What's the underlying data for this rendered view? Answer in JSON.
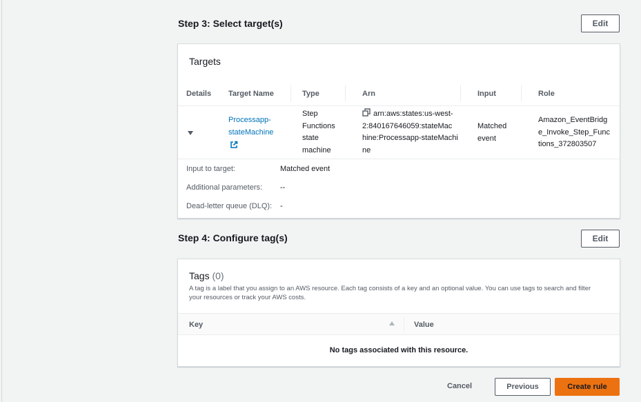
{
  "step3": {
    "title": "Step 3: Select target(s)",
    "edit_label": "Edit",
    "panel_title": "Targets",
    "columns": [
      "Details",
      "Target Name",
      "Type",
      "Arn",
      "Input",
      "Role"
    ],
    "row": {
      "name": "Processapp-stateMachine",
      "name_lines": [
        "Processapp-",
        "stateMachine"
      ],
      "type_lines": [
        "Step",
        "Functions",
        "state",
        "machine"
      ],
      "arn_lines": [
        "arn:aws:states:us-west-",
        "2:840167646059:stateMac",
        "hine:Processapp-stateMachi",
        "ne"
      ],
      "input_lines": [
        "Matched",
        "event"
      ],
      "role_lines": [
        "Amazon_EventBridg",
        "e_Invoke_Step_Func",
        "tions_372803507"
      ]
    },
    "details": [
      {
        "label": "Input to target:",
        "value": "Matched event"
      },
      {
        "label": "Additional parameters:",
        "value": "--"
      },
      {
        "label": "Dead-letter queue (DLQ):",
        "value": "-"
      }
    ]
  },
  "step4": {
    "title": "Step 4: Configure tag(s)",
    "edit_label": "Edit",
    "panel_title": "Tags",
    "count": "(0)",
    "description": "A tag is a label that you assign to an AWS resource. Each tag consists of a key and an optional value. You can use tags to search and filter your resources or track your AWS costs.",
    "col_key": "Key",
    "col_value": "Value",
    "empty": "No tags associated with this resource."
  },
  "footer": {
    "cancel": "Cancel",
    "previous": "Previous",
    "create": "Create rule"
  }
}
